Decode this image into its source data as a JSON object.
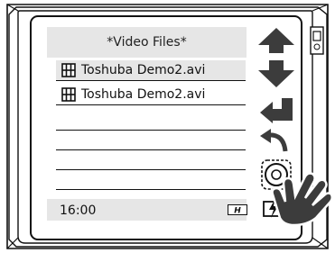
{
  "file_browser": {
    "title": "*Video Files*",
    "files": [
      {
        "name": "Toshuba Demo2.avi",
        "selected": true
      },
      {
        "name": "Toshuba Demo2.avi",
        "selected": false
      }
    ],
    "empty_rows": 4
  },
  "status_bar": {
    "time": "16:00",
    "badge_icon": "hd-badge-icon"
  },
  "controls": {
    "up_icon": "arrow-up-icon",
    "down_icon": "arrow-down-icon",
    "enter_icon": "enter-arrow-icon",
    "back_icon": "back-curve-arrow-icon",
    "disc_icon": "disc-icon",
    "charge_icon": "charging-icon",
    "pointer_icon": "hand-pointer-icon"
  },
  "colors": {
    "panel": "#e6e6e6",
    "ink": "#111111",
    "accent": "#3c3c3c"
  }
}
